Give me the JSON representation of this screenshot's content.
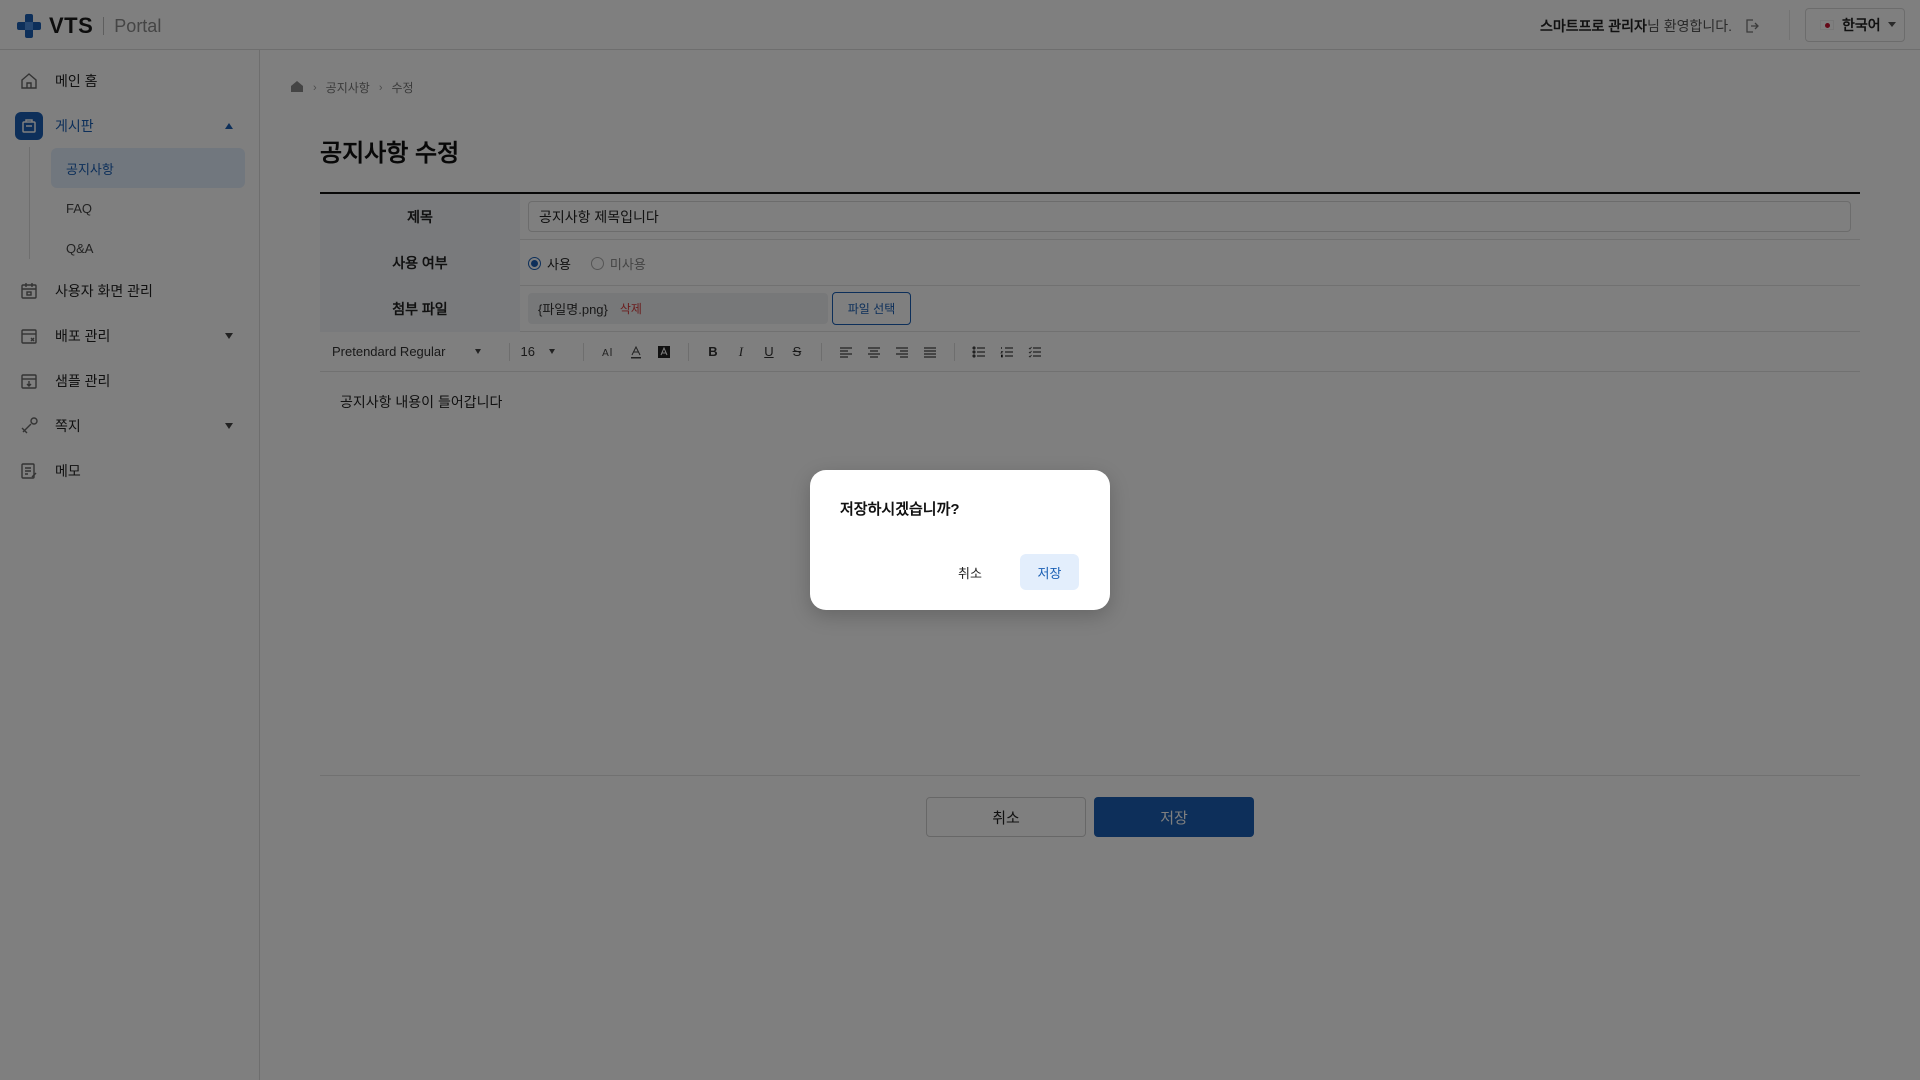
{
  "header": {
    "logo_text": "VTS",
    "logo_portal": "Portal",
    "welcome_name": "스마트프로 관리자",
    "welcome_suffix": "님 환영합니다.",
    "language": "한국어",
    "brand_color": "#1a5fb4"
  },
  "sidebar": {
    "items": [
      {
        "label": "메인 홈",
        "icon": "home-icon"
      },
      {
        "label": "게시판",
        "icon": "board-icon",
        "expanded": true,
        "active": true
      },
      {
        "label": "사용자 화면 관리",
        "icon": "calendar-icon"
      },
      {
        "label": "배포 관리",
        "icon": "deploy-icon",
        "expanded": false
      },
      {
        "label": "샘플 관리",
        "icon": "sample-icon"
      },
      {
        "label": "쪽지",
        "icon": "message-icon",
        "expanded": false
      },
      {
        "label": "메모",
        "icon": "memo-icon"
      }
    ],
    "sub_items": [
      {
        "label": "공지사항",
        "active": true
      },
      {
        "label": "FAQ"
      },
      {
        "label": "Q&A"
      }
    ]
  },
  "breadcrumb": [
    "공지사항",
    "수정"
  ],
  "page_title": "공지사항 수정",
  "form": {
    "title_label": "제목",
    "title_value": "공지사항 제목입니다",
    "use_label": "사용 여부",
    "use_option_on": "사용",
    "use_option_off": "미사용",
    "use_selected": "사용",
    "attach_label": "첨부 파일",
    "attach_file": "{파일명.png}",
    "attach_delete": "삭제",
    "attach_button": "파일 선택"
  },
  "editor": {
    "font_family": "Pretendard Regular",
    "font_size": "16",
    "content": "공지사항 내용이 들어갑니다"
  },
  "actions": {
    "cancel": "취소",
    "save": "저장"
  },
  "modal": {
    "message": "저장하시겠습니까?",
    "cancel": "취소",
    "confirm": "저장"
  }
}
